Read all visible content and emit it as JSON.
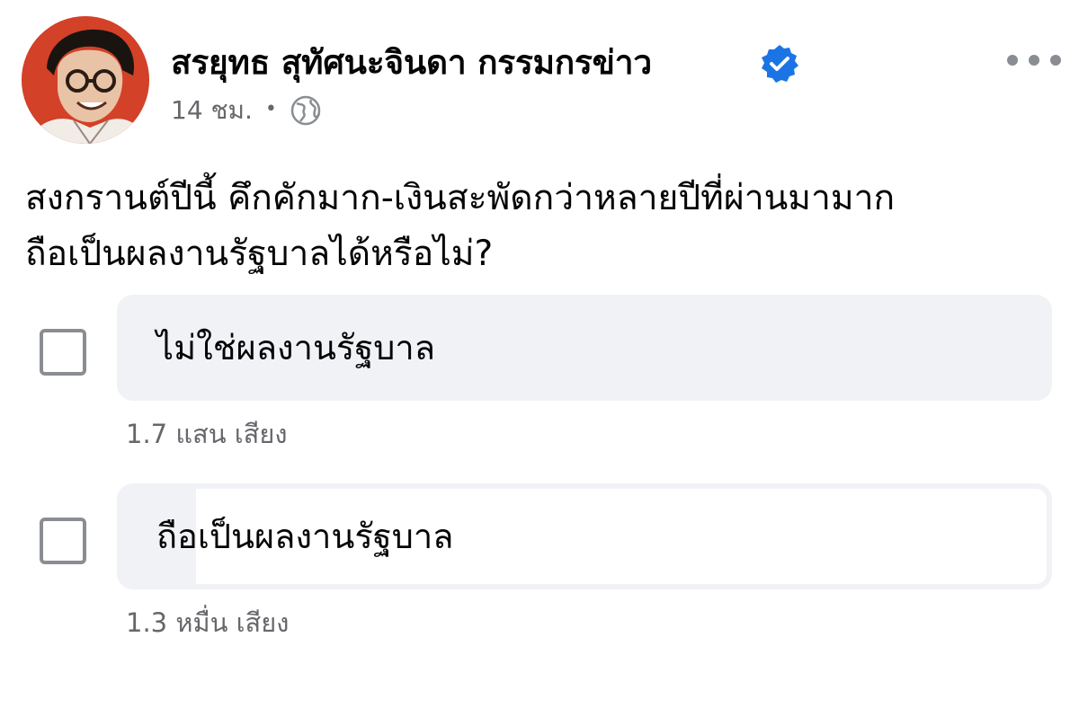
{
  "post": {
    "author": {
      "name": "สรยุทธ สุทัศนะจินดา กรรมกรข่าว",
      "verified": true,
      "avatar_icon": "avatar-photo-icon"
    },
    "timestamp": "14 ชม.",
    "separator": "•",
    "audience_icon": "globe-icon",
    "more_icon": "more-options-icon",
    "text_lines": [
      "สงกรานต์ปีนี้ คึกคักมาก-เงินสะพัดกว่าหลายปีที่ผ่านมามาก",
      "ถือเป็นผลงานรัฐบาลได้หรือไม่?"
    ]
  },
  "poll": {
    "options": [
      {
        "label": "ไม่ใช่ผลงานรัฐบาล",
        "votes_text": "1.7 แสน เสียง",
        "share": 1.0
      },
      {
        "label": "ถือเป็นผลงานรัฐบาล",
        "votes_text": "1.3 หมื่น เสียง",
        "share": 0.085
      }
    ]
  },
  "colors": {
    "verified_badge": "#1b74e4",
    "secondary_text": "#65676b",
    "poll_fill": "#f0f2f5",
    "avatar_bg": "#d9462c"
  }
}
